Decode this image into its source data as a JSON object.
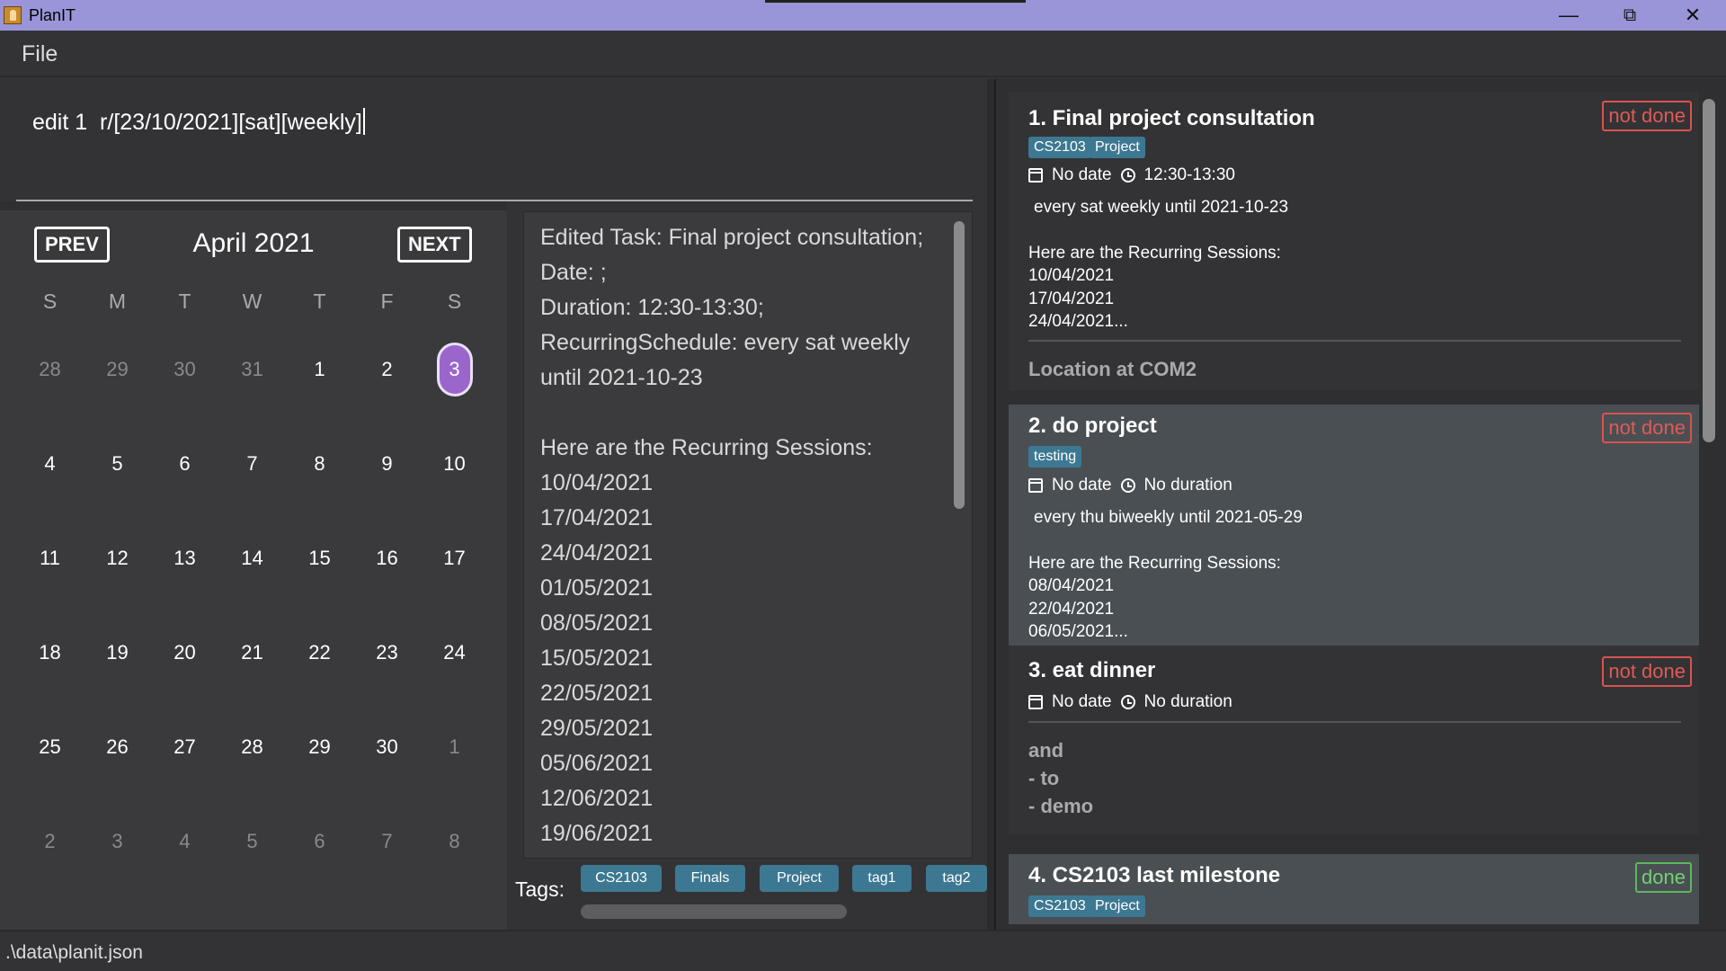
{
  "window": {
    "title": "PlanIT",
    "minimize": "—",
    "restore": "⧉",
    "close": "✕"
  },
  "menu": {
    "file": "File"
  },
  "command": {
    "value": "edit 1  r/[23/10/2021][sat][weekly]"
  },
  "calendar": {
    "prev": "PREV",
    "next": "NEXT",
    "month_label": "April 2021",
    "weekdays": [
      "S",
      "M",
      "T",
      "W",
      "T",
      "F",
      "S"
    ],
    "weeks": [
      [
        "28",
        "29",
        "30",
        "31",
        "1",
        "2",
        "3"
      ],
      [
        "4",
        "5",
        "6",
        "7",
        "8",
        "9",
        "10"
      ],
      [
        "11",
        "12",
        "13",
        "14",
        "15",
        "16",
        "17"
      ],
      [
        "18",
        "19",
        "20",
        "21",
        "22",
        "23",
        "24"
      ],
      [
        "25",
        "26",
        "27",
        "28",
        "29",
        "30",
        "1"
      ],
      [
        "2",
        "3",
        "4",
        "5",
        "6",
        "7",
        "8"
      ]
    ],
    "selected_day": "3"
  },
  "result": {
    "lines": [
      "Edited Task: Final project consultation;",
      "Date: ;",
      "Duration: 12:30-13:30;",
      "RecurringSchedule:  every sat weekly",
      "until 2021-10-23",
      "",
      "Here are the Recurring Sessions:",
      "10/04/2021",
      "17/04/2021",
      "24/04/2021",
      "01/05/2021",
      "08/05/2021",
      "15/05/2021",
      "22/05/2021",
      "29/05/2021",
      "05/06/2021",
      "12/06/2021",
      "19/06/2021"
    ]
  },
  "tags": {
    "label": "Tags:",
    "items": [
      "CS2103",
      "Finals",
      "Project",
      "tag1",
      "tag2"
    ]
  },
  "tasks": [
    {
      "title": "1.  Final project consultation",
      "status": "not done",
      "tags": [
        "CS2103",
        "Project"
      ],
      "date": "No date",
      "duration": "12:30-13:30",
      "recurring": "every sat weekly until 2021-10-23",
      "sessions_header": "Here are the Recurring Sessions:",
      "sessions": [
        "10/04/2021",
        "17/04/2021",
        "24/04/2021..."
      ],
      "description": "Location at COM2"
    },
    {
      "title": "2.  do project",
      "status": "not done",
      "tags": [
        "testing"
      ],
      "date": "No date",
      "duration": "No duration",
      "recurring": "every thu biweekly until 2021-05-29",
      "sessions_header": "Here are the Recurring Sessions:",
      "sessions": [
        "08/04/2021",
        "22/04/2021",
        "06/05/2021..."
      ]
    },
    {
      "title": "3.  eat dinner",
      "status": "not done",
      "date": "No date",
      "duration": "No duration",
      "description_lines": [
        "and",
        "- to",
        "- demo"
      ]
    },
    {
      "title": "4.  CS2103 last milestone",
      "status": "done",
      "tags": [
        "CS2103",
        "Project"
      ]
    }
  ],
  "status_bar": {
    "path": ".\\data\\planit.json"
  }
}
